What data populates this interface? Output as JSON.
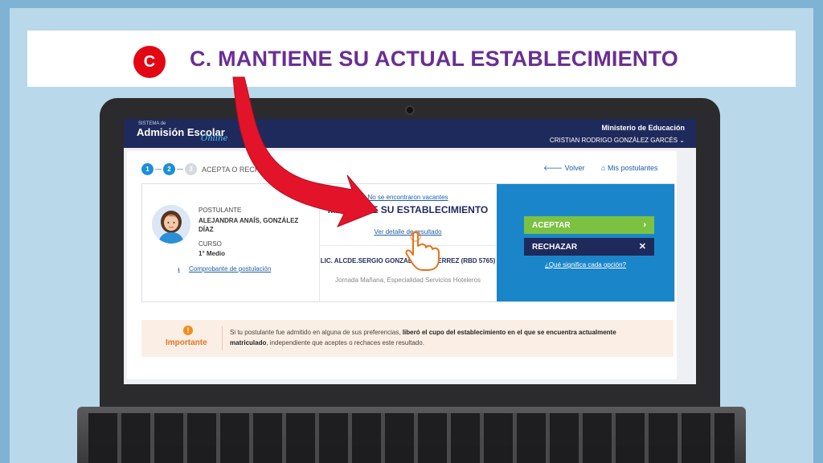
{
  "slide": {
    "badge": "C",
    "title": "C. MANTIENE SU ACTUAL ESTABLECIMIENTO"
  },
  "app": {
    "logo_small": "SISTEMA de",
    "logo_main": "Admisión Escolar",
    "logo_online": "Online",
    "ministry": "Ministerio de Educación",
    "user_name": "CRISTIAN RODRIGO GONZÁLEZ GARCÉS"
  },
  "steps": {
    "items": [
      "1",
      "2",
      "3"
    ],
    "label": "ACEPTA O RECHAZA"
  },
  "nav": {
    "volver": "Volver",
    "mis_postulantes": "Mis postulantes"
  },
  "postulante": {
    "label": "POSTULANTE",
    "name": "ALEJANDRA ANAÍS, GONZÁLEZ DÍAZ",
    "curso_label": "CURSO",
    "curso": "1° Medio",
    "comprobante": "Comprobante de postulación"
  },
  "result": {
    "no_vacantes": "No se encontraron vacantes",
    "status": "MANTIENE SU ESTABLECIMIENTO",
    "detalle": "Ver detalle de resultado",
    "school": "LIC. ALCDE.SERGIO GONZALEZ GUTIERREZ (RBD 5765)",
    "school_details": "Jornada Mañana, Especialidad Servicios Hoteleros"
  },
  "actions": {
    "accept": "ACEPTAR",
    "reject": "RECHAZAR",
    "help": "¿Qué significa cada opción?"
  },
  "notice": {
    "label": "Importante",
    "text_1": "Si tu postulante fue admitido en alguna de sus preferencias, ",
    "text_bold_1": "liberó el cupo del establecimiento en el que se encuentra actualmente matriculado",
    "text_2": ", independiente que aceptes o rechaces este resultado."
  },
  "colors": {
    "title": "#6a2e93",
    "badge": "#e30613",
    "topbar": "#1f2a5c",
    "panel": "#1a86c9",
    "accept": "#7cc242",
    "arrow": "#e3142a"
  }
}
